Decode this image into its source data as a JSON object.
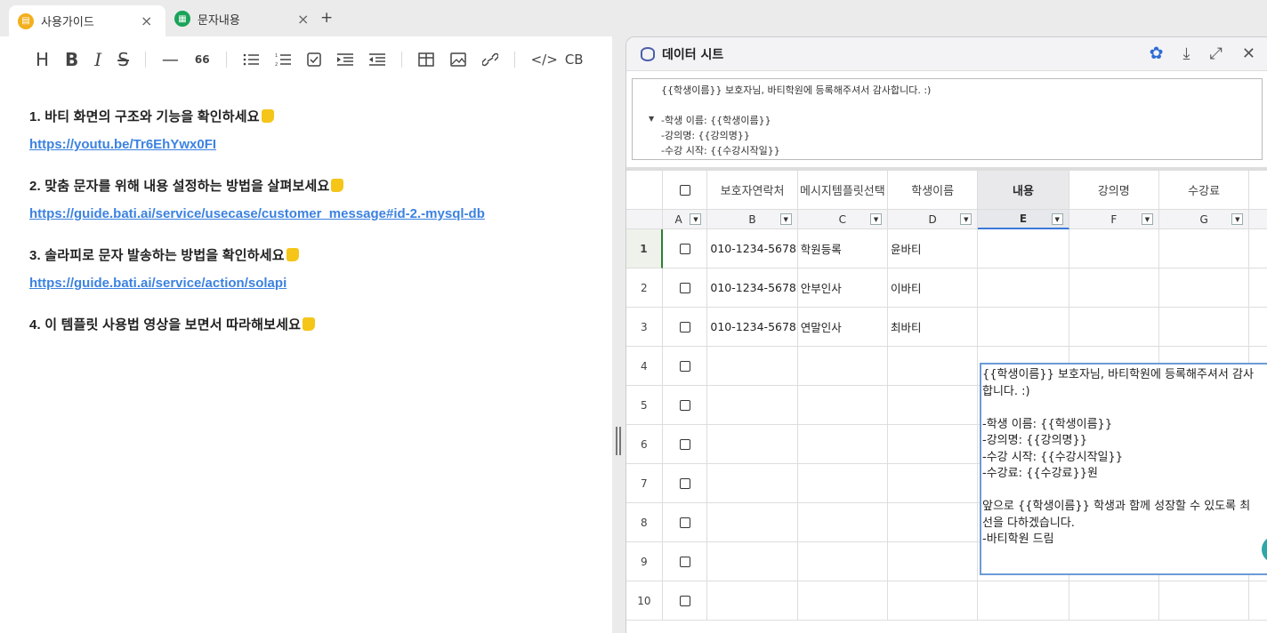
{
  "tabs": [
    {
      "label": "사용가이드",
      "icon": "guide-doc-icon",
      "icon_color": "#f2b01e",
      "active": true
    },
    {
      "label": "문자내용",
      "icon": "sheet-grid-icon",
      "icon_color": "#1aa35a",
      "active": false
    }
  ],
  "new_tab_label": "+",
  "toolbar": {
    "heading": "H",
    "bold": "B",
    "italic": "I",
    "strike": "S",
    "hr": "—",
    "quote": "66",
    "code": "</>",
    "codeblock": "CB"
  },
  "guide_items": [
    {
      "title": "1. 바티 화면의 구조와 기능을 확인하세요",
      "link": "https://youtu.be/Tr6EhYwx0FI"
    },
    {
      "title": "2. 맞춤 문자를 위해 내용 설정하는 방법을 살펴보세요",
      "link": "https://guide.bati.ai/service/usecase/customer_message#id-2.-mysql-db"
    },
    {
      "title": "3. 솔라피로 문자 발송하는 방법을 확인하세요",
      "link": "https://guide.bati.ai/service/action/solapi"
    },
    {
      "title": "4. 이 템플릿 사용법 영상을 보면서 따라해보세요",
      "link": ""
    }
  ],
  "sheet": {
    "title": "데이터 시트",
    "formula_lines": "{{학생이름}} 보호자님, 바티학원에 등록해주셔서 감사합니다. :)\n\n-학생 이름: {{학생이름}}\n-강의명: {{강의명}}\n-수강 시작: {{수강시작일}}",
    "headers": [
      "보호자연락처",
      "메시지템플릿선택",
      "학생이름",
      "내용",
      "강의명",
      "수강료"
    ],
    "letters": [
      "A",
      "B",
      "C",
      "D",
      "E",
      "F",
      "G"
    ],
    "selected_column": "E",
    "rows": [
      {
        "num": "1",
        "phone": "010-1234-5678",
        "template": "학원등록",
        "name": "윤바티"
      },
      {
        "num": "2",
        "phone": "010-1234-5678",
        "template": "안부인사",
        "name": "이바티"
      },
      {
        "num": "3",
        "phone": "010-1234-5678",
        "template": "연말인사",
        "name": "최바티"
      },
      {
        "num": "4",
        "phone": "",
        "template": "",
        "name": ""
      },
      {
        "num": "5",
        "phone": "",
        "template": "",
        "name": ""
      },
      {
        "num": "6",
        "phone": "",
        "template": "",
        "name": ""
      },
      {
        "num": "7",
        "phone": "",
        "template": "",
        "name": ""
      },
      {
        "num": "8",
        "phone": "",
        "template": "",
        "name": ""
      },
      {
        "num": "9",
        "phone": "",
        "template": "",
        "name": ""
      },
      {
        "num": "10",
        "phone": "",
        "template": "",
        "name": ""
      }
    ],
    "cell_editor_text": "{{학생이름}} 보호자님, 바티학원에 등록해주셔서 감사\n합니다. :)\n\n-학생 이름: {{학생이름}}\n-강의명: {{강의명}}\n-수강 시작: {{수강시작일}}\n-수강료: {{수강료}}원\n\n앞으로 {{학생이름}} 학생과 함께 성장할 수 있도록 최\n선을 다하겠습니다.\n-바티학원 드림"
  }
}
